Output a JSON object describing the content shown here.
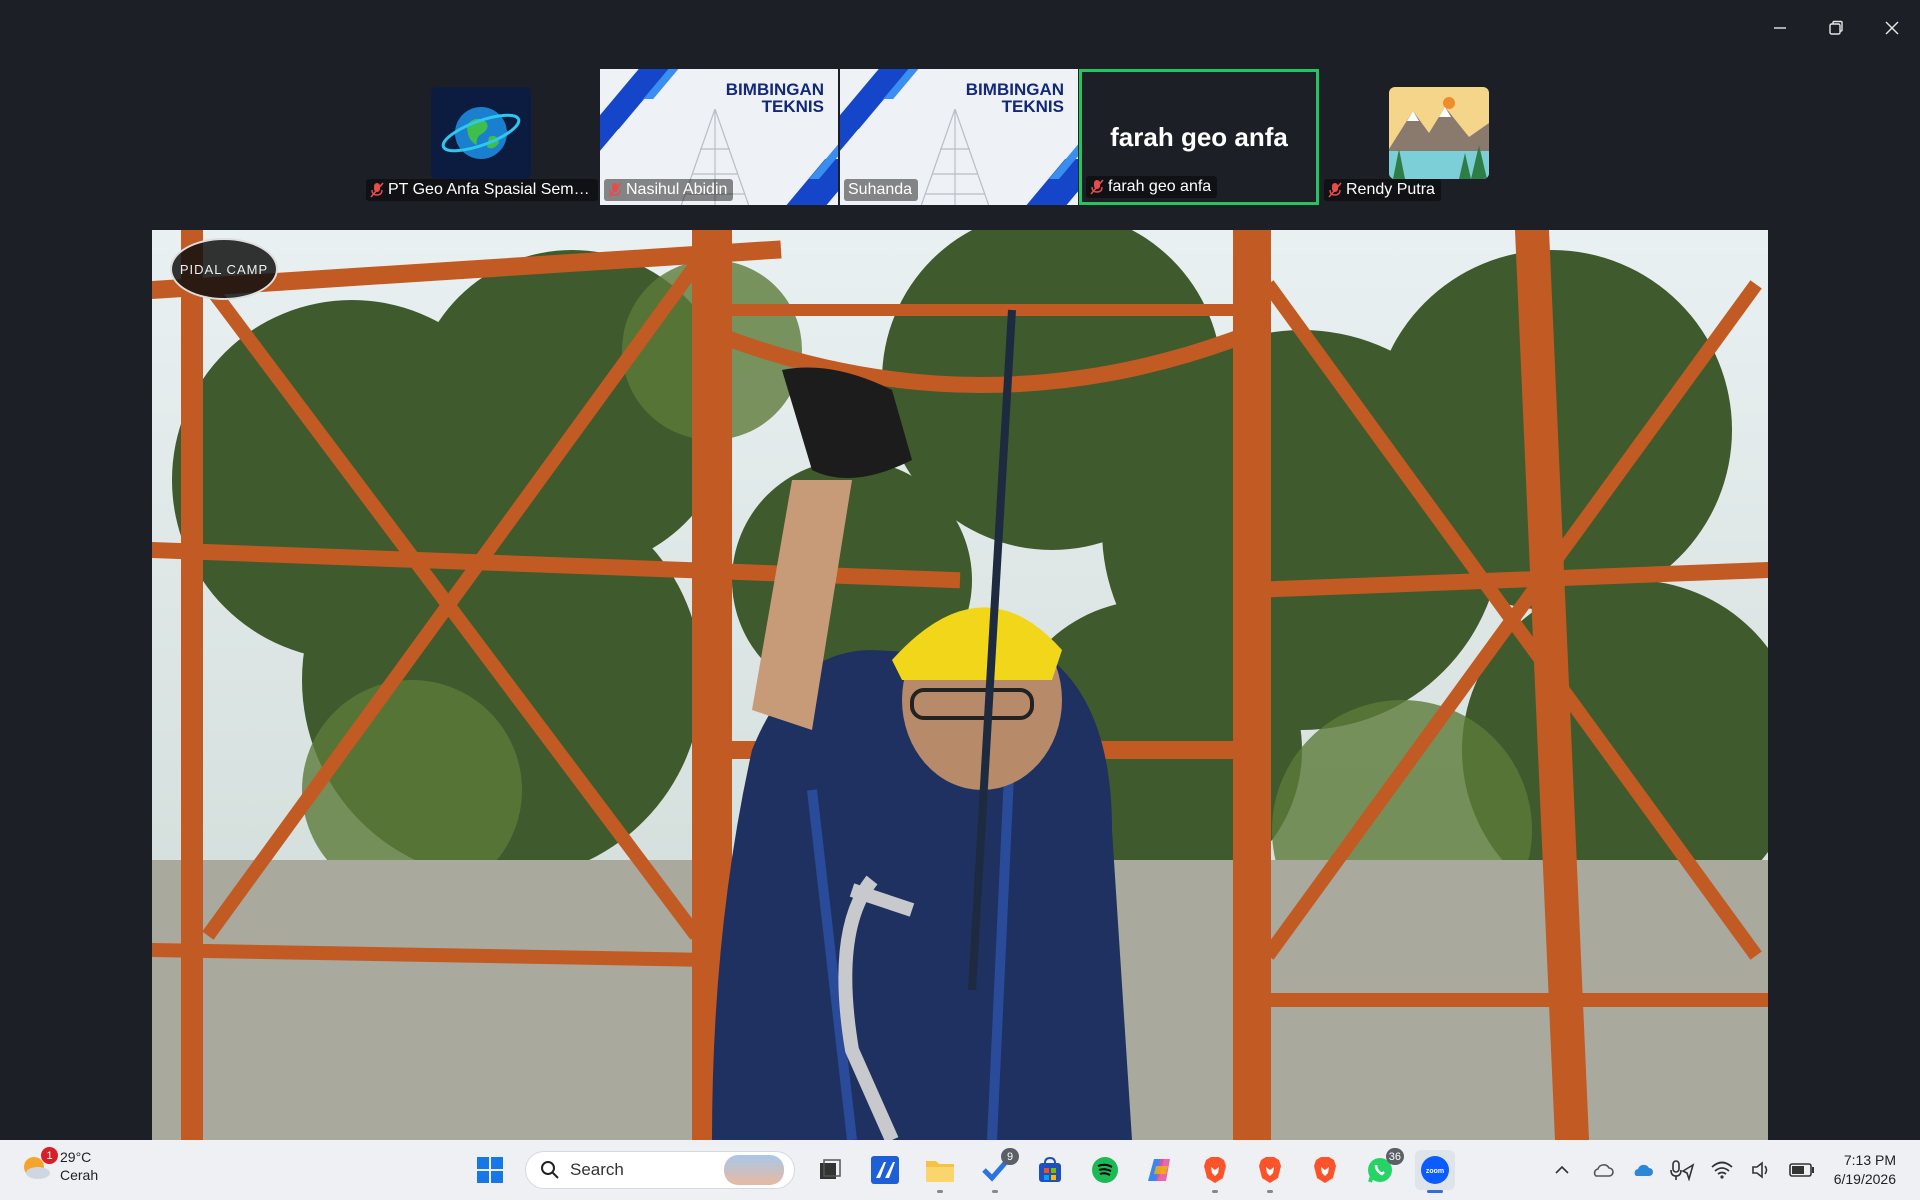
{
  "window": {
    "controls": {
      "minimize_icon": "minimize-icon",
      "restore_icon": "restore-icon",
      "close_icon": "close-icon"
    }
  },
  "participants": [
    {
      "name": "PT Geo Anfa Spasial Semara...",
      "muted": true,
      "type": "avatar",
      "avatar": "globe-logo"
    },
    {
      "name": "Nasihul Abidin",
      "muted": true,
      "type": "video",
      "banner_title_1": "BIMBINGAN",
      "banner_title_2": "TEKNIS"
    },
    {
      "name": "Suhanda",
      "muted": false,
      "type": "video",
      "banner_title_1": "BIMBINGAN",
      "banner_title_2": "TEKNIS"
    },
    {
      "name": "farah geo anfa",
      "muted": true,
      "type": "name",
      "display_name": "farah geo anfa",
      "active_speaker": true
    },
    {
      "name": "Rendy Putra",
      "muted": true,
      "type": "avatar",
      "avatar": "mountain-landscape"
    }
  ],
  "main_video": {
    "description_icon": "shared-video",
    "logo_text": "PIDAL CAMP"
  },
  "taskbar": {
    "weather": {
      "temp": "29°C",
      "condition": "Cerah",
      "badge": "1"
    },
    "search_placeholder": "Search",
    "apps": [
      {
        "name": "start",
        "icon": "windows-icon"
      },
      {
        "name": "task-view",
        "icon": "task-view-icon"
      },
      {
        "name": "app-a",
        "icon": "app-blue-icon"
      },
      {
        "name": "file-explorer",
        "icon": "folder-icon",
        "running": true
      },
      {
        "name": "todo",
        "icon": "check-icon",
        "badge": "9",
        "running": true
      },
      {
        "name": "store",
        "icon": "store-icon"
      },
      {
        "name": "spotify",
        "icon": "spotify-icon"
      },
      {
        "name": "copilot",
        "icon": "copilot-icon"
      },
      {
        "name": "brave-1",
        "icon": "brave-icon",
        "running": true
      },
      {
        "name": "brave-2",
        "icon": "brave-icon",
        "running": true
      },
      {
        "name": "brave-3",
        "icon": "brave-icon"
      },
      {
        "name": "whatsapp",
        "icon": "whatsapp-icon",
        "badge": "36"
      },
      {
        "name": "zoom",
        "icon": "zoom-icon",
        "running": true,
        "active": true
      }
    ],
    "clock": {
      "time": "7:13 PM",
      "date": "6/19/2026"
    }
  }
}
